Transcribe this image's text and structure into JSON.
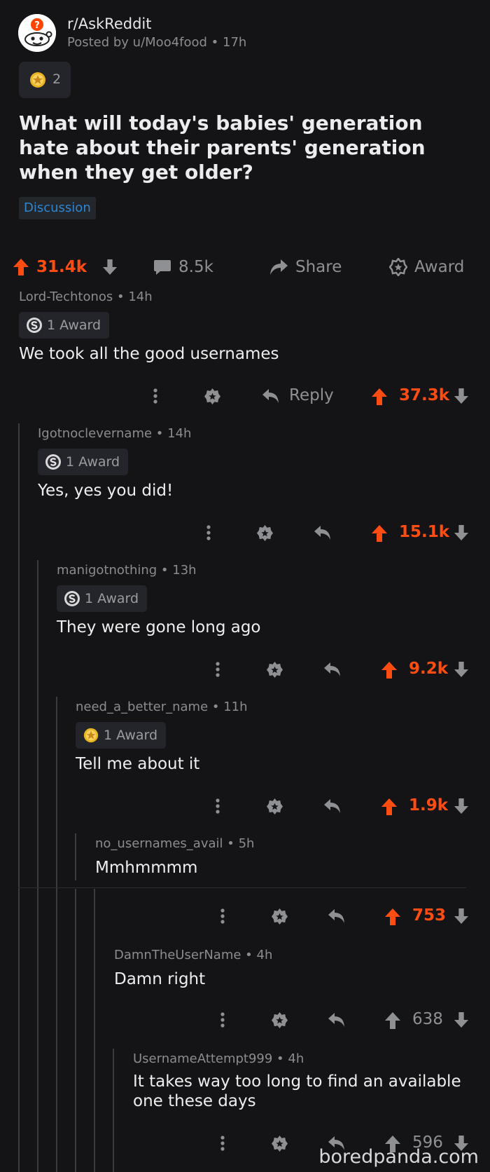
{
  "post": {
    "subreddit": "r/AskReddit",
    "posted_by": "Posted by u/Moo4food • 17h",
    "award_count": "2",
    "title": "What will today's babies' generation hate about their parents' generation when they get older?",
    "flair": "Discussion",
    "upvotes": "31.4k",
    "comments": "8.5k",
    "share_label": "Share",
    "award_label": "Award"
  },
  "comments": [
    {
      "meta": "Lord-Techtonos • 14h",
      "award": "1 Award",
      "body": "We took all the good usernames",
      "reply_label": "Reply",
      "votes": "37.3k"
    },
    {
      "meta": "Igotnoclevername • 14h",
      "award": "1 Award",
      "body": "Yes, yes you did!",
      "votes": "15.1k"
    },
    {
      "meta": "manigotnothing • 13h",
      "award": "1 Award",
      "body": "They were gone long ago",
      "votes": "9.2k"
    },
    {
      "meta": "need_a_better_name • 11h",
      "award": "1 Award",
      "body": "Tell me about it",
      "votes": "1.9k"
    },
    {
      "meta": "no_usernames_avail • 5h",
      "body": "Mmhmmmm",
      "votes": "753"
    },
    {
      "meta": "DamnTheUserName • 4h",
      "body": "Damn right",
      "votes": "638"
    },
    {
      "meta": "UsernameAttempt999 • 4h",
      "body": "It takes way too long to find an available one these days",
      "votes": "596"
    }
  ],
  "watermark": "boredpanda.com",
  "colors": {
    "background": "#141416",
    "upvote": "#ff4d12",
    "flair": "#2f86cf",
    "muted": "#8a8c90"
  }
}
